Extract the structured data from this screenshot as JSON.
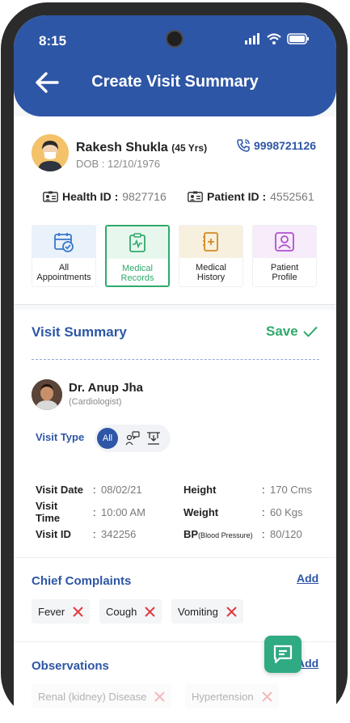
{
  "status": {
    "time": "8:15"
  },
  "header": {
    "title": "Create Visit Summary"
  },
  "patient": {
    "name": "Rakesh Shukla",
    "age": "(45 Yrs)",
    "dob": "DOB : 12/10/1976",
    "phone": "9998721126",
    "health_id_label": "Health ID :",
    "health_id": "9827716",
    "patient_id_label": "Patient ID :",
    "patient_id": "4552561"
  },
  "tiles": [
    {
      "line1": "All",
      "line2": "Appointments",
      "bg": "#e9f2fb",
      "icon": "calendar-check-icon"
    },
    {
      "line1": "Medical",
      "line2": "Records",
      "bg": "#e8f7ee",
      "icon": "clipboard-pulse-icon",
      "active": true
    },
    {
      "line1": "Medical",
      "line2": "History",
      "bg": "#f8f0df",
      "icon": "medical-file-icon"
    },
    {
      "line1": "Patient",
      "line2": "Profile",
      "bg": "#f6ecfa",
      "icon": "profile-icon"
    }
  ],
  "visit": {
    "title": "Visit Summary",
    "save_label": "Save",
    "doctor_name": "Dr. Anup Jha",
    "doctor_specialty": "(Cardiologist)",
    "visit_type_label": "Visit Type",
    "visit_type_selected": "All",
    "rows": [
      {
        "label": "Visit Date",
        "value": "08/02/21"
      },
      {
        "label": "Visit Time",
        "value": "10:00 AM"
      },
      {
        "label": "Visit ID",
        "value": "342256"
      }
    ],
    "vitals": [
      {
        "label": "Height",
        "value": "170 Cms"
      },
      {
        "label": "Weight",
        "value": "60 Kgs"
      },
      {
        "label": "BP",
        "sub": "(Blood Pressure)",
        "value": "80/120"
      }
    ],
    "colon": ":"
  },
  "complaints": {
    "title": "Chief Complaints",
    "add_label": "Add",
    "items": [
      "Fever",
      "Cough",
      "Vomiting"
    ]
  },
  "observations": {
    "title": "Observations",
    "add_label": "Add",
    "items": [
      "Renal (kidney) Disease",
      "Hypertension"
    ]
  },
  "colors": {
    "primary": "#2e56a6",
    "accent": "#2faa6b",
    "remove": "#e0393e"
  }
}
